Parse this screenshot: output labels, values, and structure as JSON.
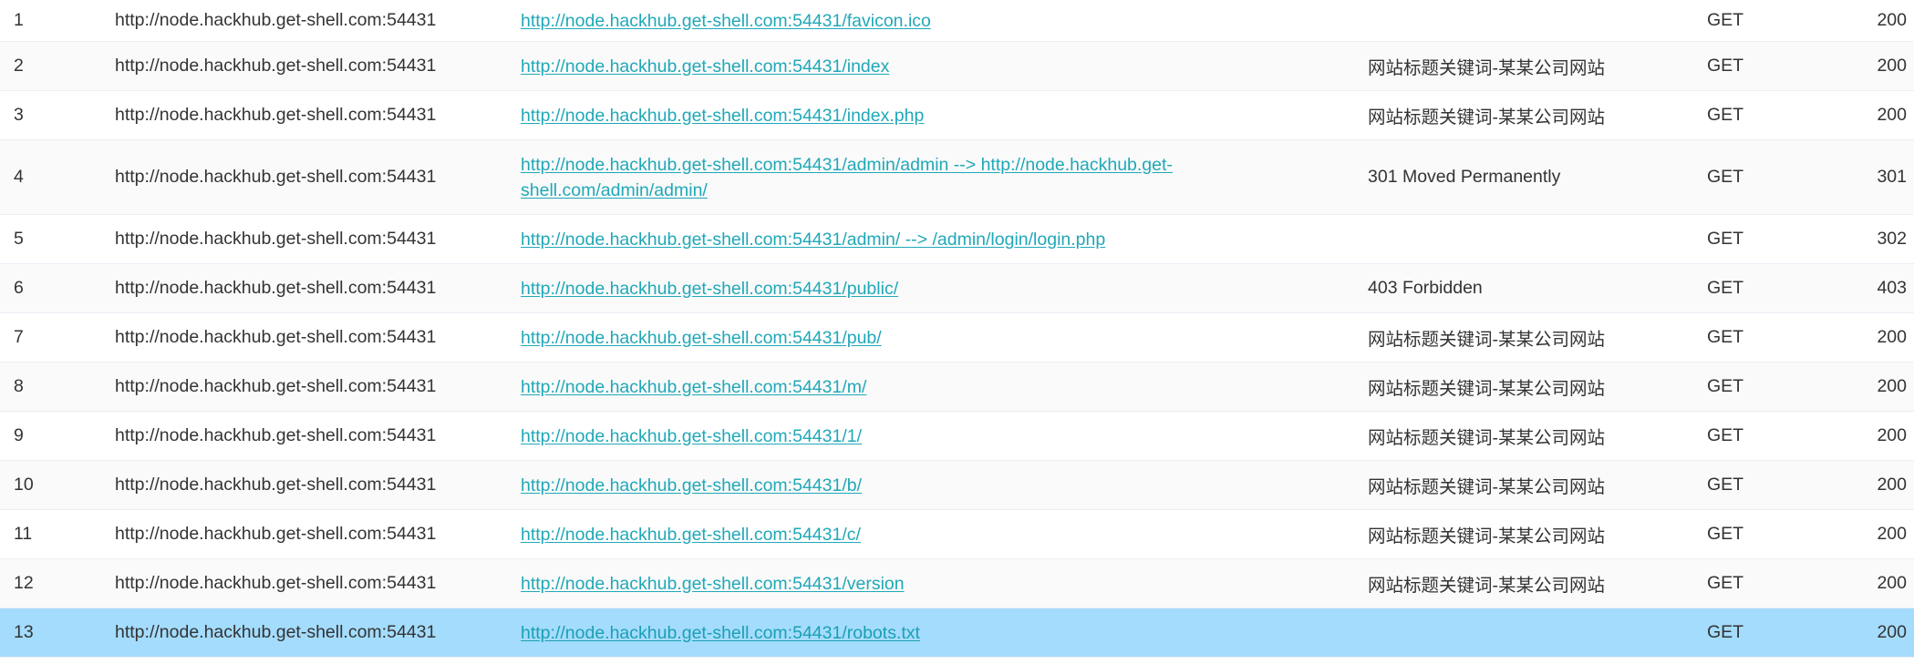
{
  "rows": [
    {
      "no": "1",
      "host": "http://node.hackhub.get-shell.com:54431",
      "url": "http://node.hackhub.get-shell.com:54431/favicon.ico",
      "title": "",
      "method": "GET",
      "status": "200"
    },
    {
      "no": "2",
      "host": "http://node.hackhub.get-shell.com:54431",
      "url": "http://node.hackhub.get-shell.com:54431/index",
      "title": "网站标题关键词-某某公司网站",
      "method": "GET",
      "status": "200"
    },
    {
      "no": "3",
      "host": "http://node.hackhub.get-shell.com:54431",
      "url": "http://node.hackhub.get-shell.com:54431/index.php",
      "title": "网站标题关键词-某某公司网站",
      "method": "GET",
      "status": "200"
    },
    {
      "no": "4",
      "host": "http://node.hackhub.get-shell.com:54431",
      "url": "http://node.hackhub.get-shell.com:54431/admin/admin --> http://node.hackhub.get-shell.com/admin/admin/",
      "title": "301 Moved Permanently",
      "method": "GET",
      "status": "301"
    },
    {
      "no": "5",
      "host": "http://node.hackhub.get-shell.com:54431",
      "url": "http://node.hackhub.get-shell.com:54431/admin/ --> /admin/login/login.php",
      "title": "",
      "method": "GET",
      "status": "302"
    },
    {
      "no": "6",
      "host": "http://node.hackhub.get-shell.com:54431",
      "url": "http://node.hackhub.get-shell.com:54431/public/",
      "title": "403 Forbidden",
      "method": "GET",
      "status": "403"
    },
    {
      "no": "7",
      "host": "http://node.hackhub.get-shell.com:54431",
      "url": "http://node.hackhub.get-shell.com:54431/pub/",
      "title": "网站标题关键词-某某公司网站",
      "method": "GET",
      "status": "200"
    },
    {
      "no": "8",
      "host": "http://node.hackhub.get-shell.com:54431",
      "url": "http://node.hackhub.get-shell.com:54431/m/",
      "title": "网站标题关键词-某某公司网站",
      "method": "GET",
      "status": "200"
    },
    {
      "no": "9",
      "host": "http://node.hackhub.get-shell.com:54431",
      "url": "http://node.hackhub.get-shell.com:54431/1/",
      "title": "网站标题关键词-某某公司网站",
      "method": "GET",
      "status": "200"
    },
    {
      "no": "10",
      "host": "http://node.hackhub.get-shell.com:54431",
      "url": "http://node.hackhub.get-shell.com:54431/b/",
      "title": "网站标题关键词-某某公司网站",
      "method": "GET",
      "status": "200"
    },
    {
      "no": "11",
      "host": "http://node.hackhub.get-shell.com:54431",
      "url": "http://node.hackhub.get-shell.com:54431/c/",
      "title": "网站标题关键词-某某公司网站",
      "method": "GET",
      "status": "200"
    },
    {
      "no": "12",
      "host": "http://node.hackhub.get-shell.com:54431",
      "url": "http://node.hackhub.get-shell.com:54431/version",
      "title": "网站标题关键词-某某公司网站",
      "method": "GET",
      "status": "200"
    },
    {
      "no": "13",
      "host": "http://node.hackhub.get-shell.com:54431",
      "url": "http://node.hackhub.get-shell.com:54431/robots.txt",
      "title": "",
      "method": "GET",
      "status": "200"
    }
  ],
  "selected_row": "13",
  "colors": {
    "link": "#20a8b8",
    "selected_row_bg": "#a4dcfd",
    "stripe_bg": "#fafafa",
    "text": "#333333"
  }
}
